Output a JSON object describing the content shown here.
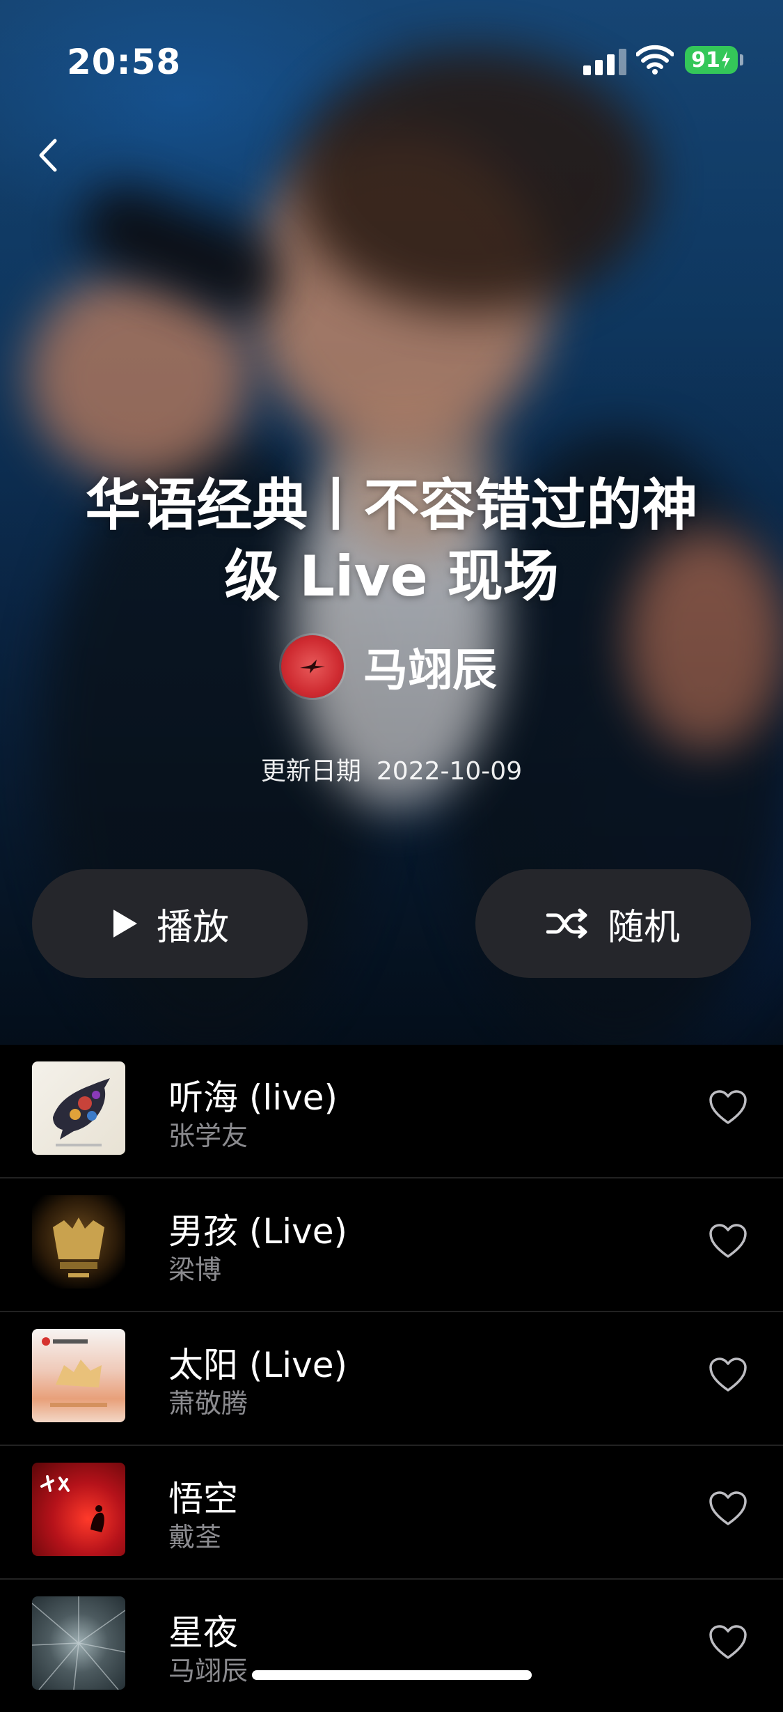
{
  "status_bar": {
    "time": "20:58",
    "battery": "91"
  },
  "playlist": {
    "title_line1": "华语经典丨不容错过的神",
    "title_line2": "级 Live 现场",
    "curator": "马翊辰",
    "updated_label": "更新日期",
    "updated_date": "2022-10-09"
  },
  "actions": {
    "play_label": "播放",
    "shuffle_label": "随机"
  },
  "tracks": [
    {
      "title": "听海 (live)",
      "artist": "张学友"
    },
    {
      "title": "男孩 (Live)",
      "artist": "梁博"
    },
    {
      "title": "太阳 (Live)",
      "artist": "萧敬腾"
    },
    {
      "title": "悟空",
      "artist": "戴荃"
    },
    {
      "title": "星夜",
      "artist": "马翊辰"
    }
  ],
  "icons": {
    "back": "chevron-left-icon",
    "play": "play-icon",
    "shuffle": "shuffle-icon",
    "heart": "heart-icon"
  },
  "colors": {
    "battery": "#34c759",
    "curator_avatar": "#cf2b31"
  }
}
